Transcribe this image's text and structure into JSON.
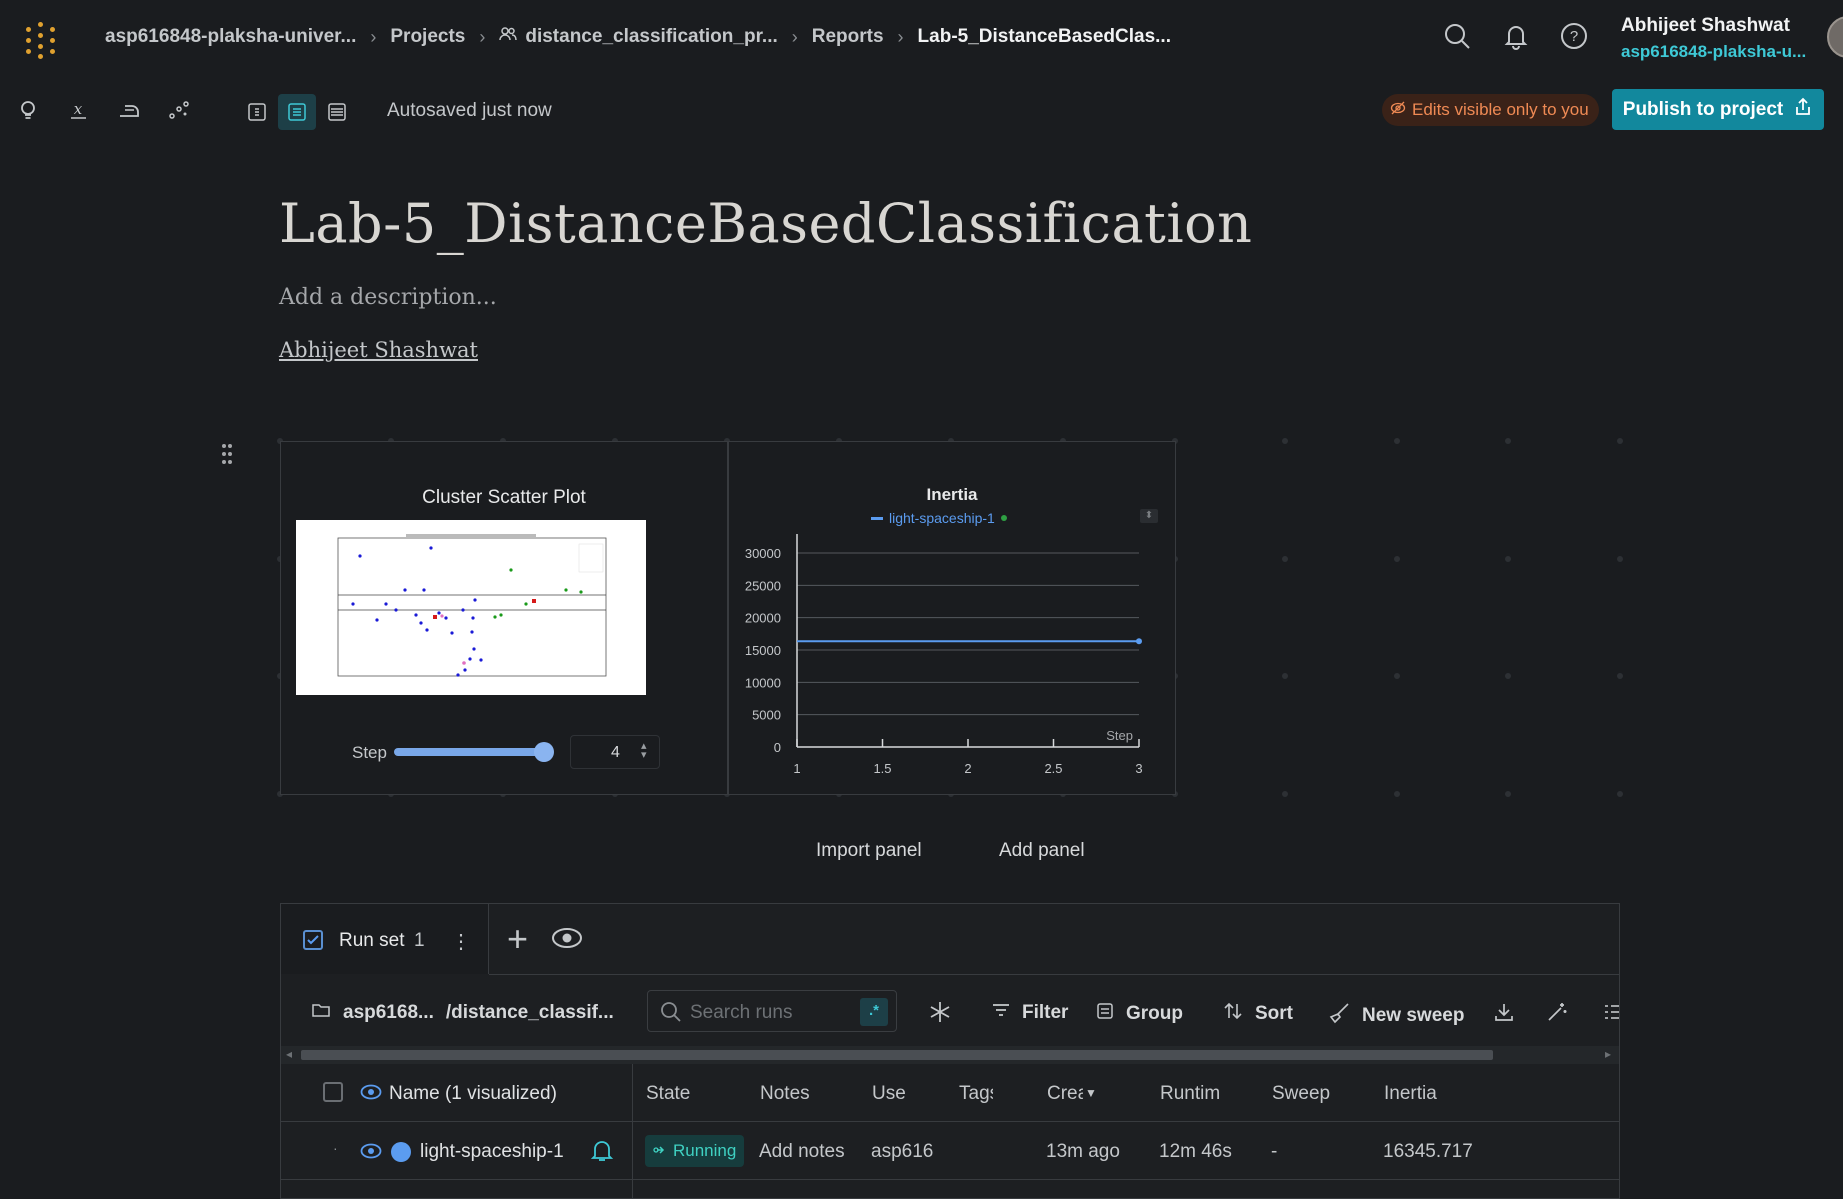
{
  "nav": {
    "breadcrumbs": [
      "asp616848-plaksha-univer...",
      "Projects",
      "distance_classification_pr...",
      "Reports",
      "Lab-5_DistanceBasedClas..."
    ],
    "user_name": "Abhijeet Shashwat",
    "user_org": "asp616848-plaksha-u..."
  },
  "toolbar": {
    "autosave": "Autosaved just now",
    "edits_badge": "Edits visible only to you",
    "publish_label": "Publish to project",
    "icons": [
      "lightbulb-icon",
      "formula-icon",
      "iron-icon",
      "scatter-icon",
      "width-narrow-icon",
      "width-medium-icon",
      "width-wide-icon"
    ]
  },
  "report": {
    "title": "Lab-5_DistanceBasedClassification",
    "description_placeholder": "Add a description...",
    "author": "Abhijeet Shashwat"
  },
  "panels": {
    "scatter": {
      "title": "Cluster Scatter Plot",
      "step_label": "Step",
      "step_value": "4",
      "slider_fraction": 1.0
    },
    "inertia": {
      "title": "Inertia",
      "legend": "light-spaceship-1",
      "step_axis_label": "Step"
    },
    "import_label": "Import panel",
    "add_label": "Add panel"
  },
  "chart_data": {
    "type": "line",
    "title": "Inertia",
    "xlabel": "Step",
    "ylabel": "",
    "x_ticks": [
      "1",
      "1.5",
      "2",
      "2.5",
      "3"
    ],
    "y_ticks": [
      "0",
      "5000",
      "10000",
      "15000",
      "20000",
      "25000",
      "30000"
    ],
    "xlim": [
      1,
      3
    ],
    "ylim": [
      0,
      30000
    ],
    "grid": true,
    "series": [
      {
        "name": "light-spaceship-1",
        "x": [
          1,
          3
        ],
        "values": [
          16345.717,
          16345.717
        ],
        "color": "#5b9cf0"
      }
    ]
  },
  "runset": {
    "title": "Run set",
    "count": "1",
    "project_path": "asp6168...",
    "project_name": "/distance_classif...",
    "search_placeholder": "Search runs",
    "regex_label": ".*",
    "tools": {
      "filter": "Filter",
      "group": "Group",
      "sort": "Sort",
      "sweep": "New sweep"
    },
    "columns": [
      "Name (1 visualized)",
      "State",
      "Notes",
      "Use",
      "Tags",
      "Crea",
      "Runtim",
      "Sweep",
      "Inertia"
    ],
    "row": {
      "name": "light-spaceship-1",
      "state": "Running",
      "notes": "Add notes",
      "user": "asp616",
      "created": "13m ago",
      "runtime": "12m 46s",
      "sweep": "-",
      "inertia": "16345.717"
    }
  },
  "colors": {
    "accent": "#12889d",
    "cyan": "#3ec9d6",
    "running": "#3fd1c2",
    "series": "#5b9cf0",
    "warning": "#ef8a54"
  }
}
